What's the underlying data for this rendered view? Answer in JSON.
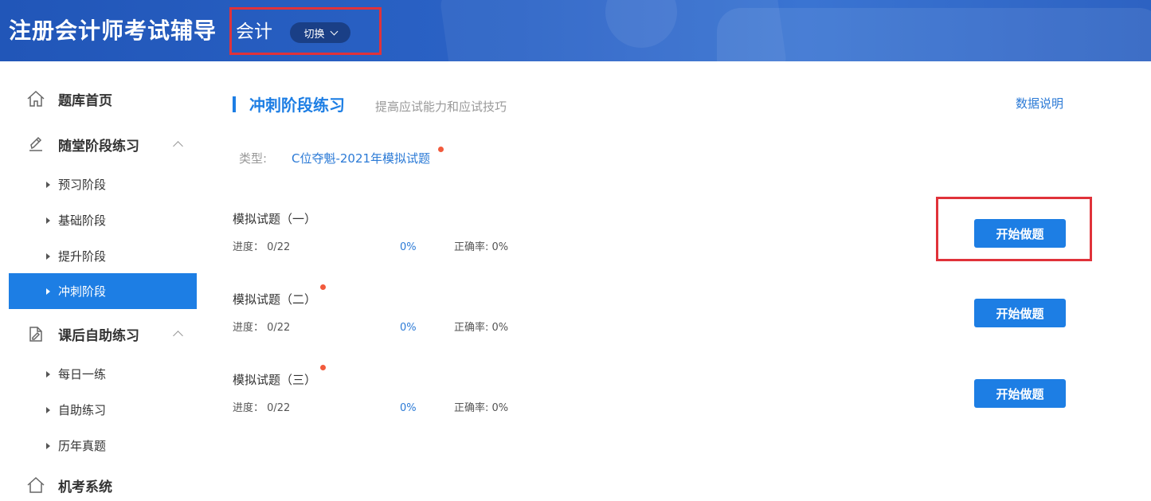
{
  "header": {
    "app_title": "注册会计师考试辅导",
    "subject": "会计",
    "switch_label": "切换"
  },
  "sidebar": {
    "home": "题库首页",
    "group1": {
      "label": "随堂阶段练习",
      "items": [
        "预习阶段",
        "基础阶段",
        "提升阶段",
        "冲刺阶段"
      ]
    },
    "group2": {
      "label": "课后自助练习",
      "items": [
        "每日一练",
        "自助练习",
        "历年真题"
      ]
    },
    "group3": {
      "label": "机考系统"
    },
    "active_item": "冲刺阶段"
  },
  "main": {
    "section_title": "冲刺阶段练习",
    "section_subtitle": "提高应试能力和应试技巧",
    "data_link": "数据说明",
    "type_label": "类型:",
    "type_value": "C位夺魁-2021年模拟试题",
    "questions": [
      {
        "title": "模拟试题（一）",
        "progress": "进度： 0/22",
        "percent": "0%",
        "accuracy": "正确率: 0%",
        "button": "开始做题"
      },
      {
        "title": "模拟试题（二）",
        "progress": "进度： 0/22",
        "percent": "0%",
        "accuracy": "正确率: 0%",
        "button": "开始做题"
      },
      {
        "title": "模拟试题（三）",
        "progress": "进度： 0/22",
        "percent": "0%",
        "accuracy": "正确率: 0%",
        "button": "开始做题"
      }
    ]
  },
  "colors": {
    "header_blue": "#2b63c6",
    "accent": "#1d7ee4",
    "link": "#2b7ad6",
    "highlight_border": "#e0323a",
    "new_dot": "#f25a3c"
  }
}
